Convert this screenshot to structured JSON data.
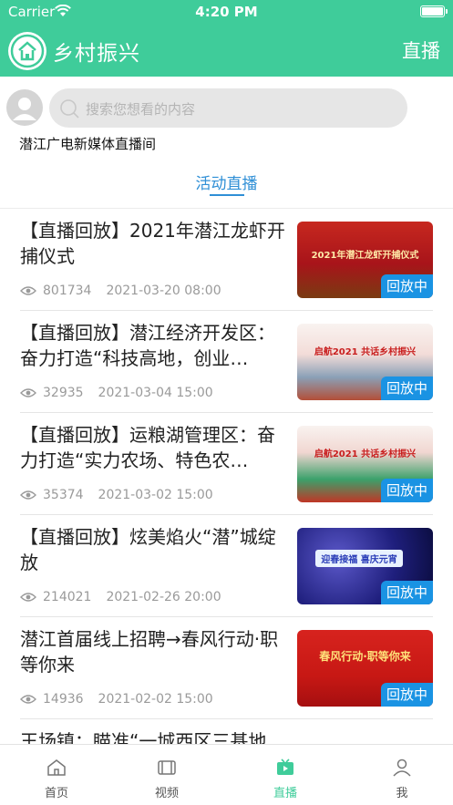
{
  "status_bar": {
    "carrier": "Carrier",
    "time": "4:20 PM"
  },
  "header": {
    "title": "乡村振兴",
    "right_label": "直播"
  },
  "search": {
    "placeholder": "搜索您想看的内容"
  },
  "channel_name": "潜江广电新媒体直播间",
  "tab": {
    "label": "活动直播"
  },
  "badge_label": "回放中",
  "items": [
    {
      "title": "【直播回放】2021年潜江龙虾开捕仪式",
      "views": "801734",
      "date": "2021-03-20 08:00",
      "badge": "回放中",
      "thumb_text": "2021年潜江龙虾开捕仪式"
    },
    {
      "title": "【直播回放】潜江经济开发区：奋力打造“科技高地，创业…",
      "views": "32935",
      "date": "2021-03-04 15:00",
      "badge": "回放中",
      "thumb_text": "启航2021 共话乡村振兴"
    },
    {
      "title": "【直播回放】运粮湖管理区：奋力打造“实力农场、特色农…",
      "views": "35374",
      "date": "2021-03-02 15:00",
      "badge": "回放中",
      "thumb_text": "启航2021 共话乡村振兴"
    },
    {
      "title": "【直播回放】炫美焰火“潜”城绽放",
      "views": "214021",
      "date": "2021-02-26 20:00",
      "badge": "回放中",
      "thumb_text": "迎春接福 喜庆元宵"
    },
    {
      "title": "潜江首届线上招聘→春风行动·职等你来",
      "views": "14936",
      "date": "2021-02-02 15:00",
      "badge": "回放中",
      "thumb_text": "春风行动·职等你来"
    },
    {
      "title": "王场镇：瞄准“一城西区三基地",
      "views": "",
      "date": "",
      "badge": "",
      "thumb_text": ""
    }
  ],
  "tabbar": [
    {
      "label": "首页",
      "icon": "home-icon"
    },
    {
      "label": "视频",
      "icon": "video-icon"
    },
    {
      "label": "直播",
      "icon": "live-tv-icon"
    },
    {
      "label": "我",
      "icon": "profile-icon"
    }
  ],
  "colors": {
    "brand": "#3fcc9a",
    "accent_blue": "#2f8fd6",
    "badge_blue": "#1a93e3"
  }
}
